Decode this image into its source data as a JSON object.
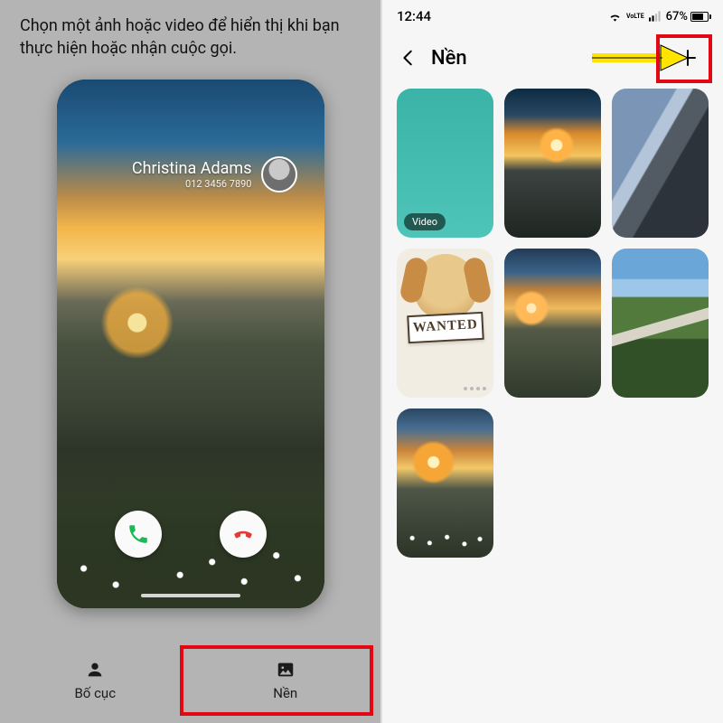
{
  "left": {
    "instruction": "Chọn một ảnh hoặc video để hiển thị khi bạn thực hiện hoặc nhận cuộc gọi.",
    "caller_name": "Christina Adams",
    "caller_number": "012 3456 7890",
    "tabs": {
      "layout": "Bố cục",
      "background": "Nền"
    }
  },
  "right": {
    "status": {
      "time": "12:44",
      "battery_pct": "67%"
    },
    "title": "Nền",
    "video_badge": "Video",
    "wanted_sign": "WANTED"
  }
}
